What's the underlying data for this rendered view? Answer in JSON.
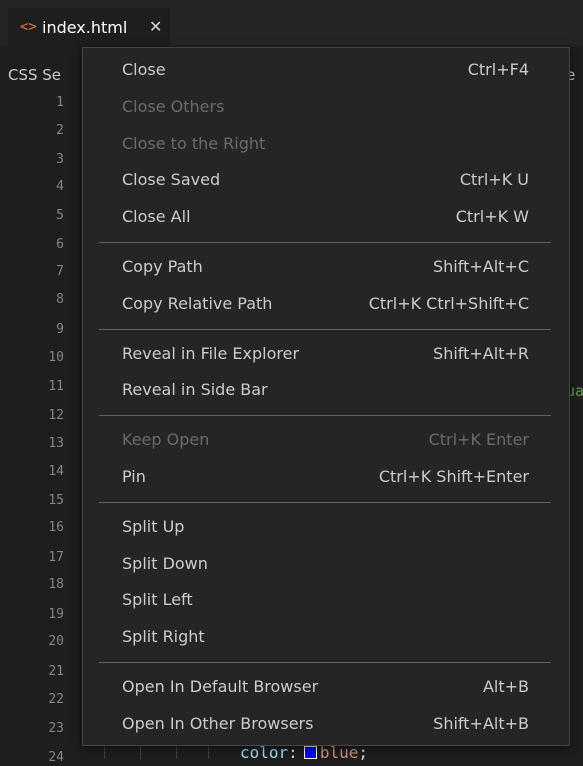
{
  "tab": {
    "icon": "html-code-icon",
    "icon_glyph": "<>",
    "label": "index.html",
    "close_glyph": "✕"
  },
  "breadcrumb": {
    "visible_text": "CSS Se",
    "trailing_text": "e"
  },
  "editor": {
    "partial_text_right": "ua",
    "line_numbers": [
      "1",
      "2",
      "3",
      "4",
      "5",
      "6",
      "7",
      "8",
      "9",
      "10",
      "11",
      "12",
      "13",
      "14",
      "15",
      "16",
      "17",
      "18",
      "19",
      "20",
      "21",
      "22",
      "23",
      "24"
    ],
    "line24": {
      "property": "color",
      "colon": ":",
      "value": "blue",
      "semicolon": ";",
      "swatch_color": "#0000ff"
    }
  },
  "context_menu": {
    "groups": [
      [
        {
          "label": "Close",
          "shortcut": "Ctrl+F4",
          "enabled": true
        },
        {
          "label": "Close Others",
          "shortcut": "",
          "enabled": false
        },
        {
          "label": "Close to the Right",
          "shortcut": "",
          "enabled": false
        },
        {
          "label": "Close Saved",
          "shortcut": "Ctrl+K U",
          "enabled": true
        },
        {
          "label": "Close All",
          "shortcut": "Ctrl+K W",
          "enabled": true
        }
      ],
      [
        {
          "label": "Copy Path",
          "shortcut": "Shift+Alt+C",
          "enabled": true
        },
        {
          "label": "Copy Relative Path",
          "shortcut": "Ctrl+K Ctrl+Shift+C",
          "enabled": true
        }
      ],
      [
        {
          "label": "Reveal in File Explorer",
          "shortcut": "Shift+Alt+R",
          "enabled": true
        },
        {
          "label": "Reveal in Side Bar",
          "shortcut": "",
          "enabled": true
        }
      ],
      [
        {
          "label": "Keep Open",
          "shortcut": "Ctrl+K Enter",
          "enabled": false
        },
        {
          "label": "Pin",
          "shortcut": "Ctrl+K Shift+Enter",
          "enabled": true
        }
      ],
      [
        {
          "label": "Split Up",
          "shortcut": "",
          "enabled": true
        },
        {
          "label": "Split Down",
          "shortcut": "",
          "enabled": true
        },
        {
          "label": "Split Left",
          "shortcut": "",
          "enabled": true
        },
        {
          "label": "Split Right",
          "shortcut": "",
          "enabled": true
        }
      ],
      [
        {
          "label": "Open In Default Browser",
          "shortcut": "Alt+B",
          "enabled": true
        },
        {
          "label": "Open In Other Browsers",
          "shortcut": "Shift+Alt+B",
          "enabled": true
        }
      ]
    ]
  },
  "colors": {
    "editor_background": "#1e1e1e",
    "menu_background": "#252526",
    "menu_text": "#cccccc",
    "menu_text_disabled": "#6b6b6b",
    "tab_icon": "#e37933"
  }
}
